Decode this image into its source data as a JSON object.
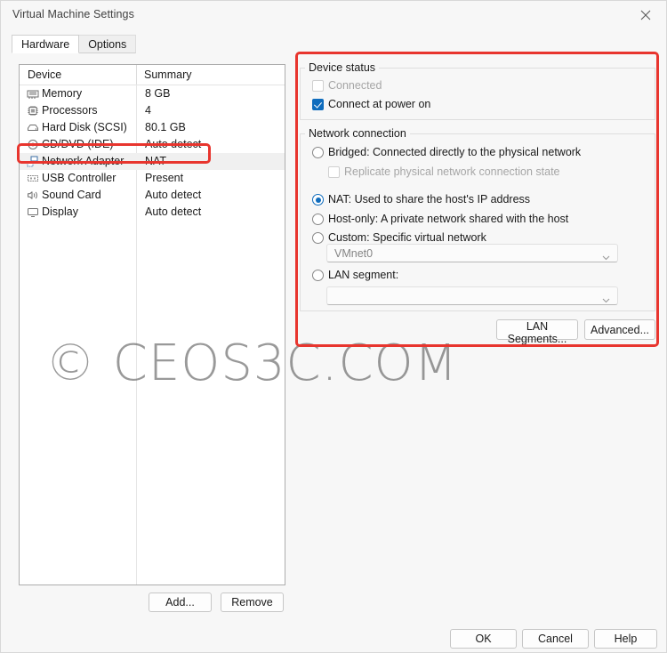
{
  "window": {
    "title": "Virtual Machine Settings",
    "close_icon": "close-icon"
  },
  "tabs": [
    {
      "label": "Hardware",
      "active": true
    },
    {
      "label": "Options",
      "active": false
    }
  ],
  "device_list": {
    "columns": {
      "device": "Device",
      "summary": "Summary"
    },
    "rows": [
      {
        "icon": "memory-icon",
        "label": "Memory",
        "summary": "8 GB",
        "selected": false
      },
      {
        "icon": "processor-icon",
        "label": "Processors",
        "summary": "4",
        "selected": false
      },
      {
        "icon": "hard-disk-icon",
        "label": "Hard Disk (SCSI)",
        "summary": "80.1 GB",
        "selected": false
      },
      {
        "icon": "cd-dvd-icon",
        "label": "CD/DVD (IDE)",
        "summary": "Auto detect",
        "selected": false
      },
      {
        "icon": "network-adapter-icon",
        "label": "Network Adapter",
        "summary": "NAT",
        "selected": true
      },
      {
        "icon": "usb-controller-icon",
        "label": "USB Controller",
        "summary": "Present",
        "selected": false
      },
      {
        "icon": "sound-card-icon",
        "label": "Sound Card",
        "summary": "Auto detect",
        "selected": false
      },
      {
        "icon": "display-icon",
        "label": "Display",
        "summary": "Auto detect",
        "selected": false
      }
    ],
    "add_label": "Add...",
    "remove_label": "Remove"
  },
  "device_status": {
    "title": "Device status",
    "connected": {
      "label": "Connected",
      "checked": false,
      "disabled": true
    },
    "connect_at_power_on": {
      "label": "Connect at power on",
      "checked": true,
      "disabled": false
    }
  },
  "network_connection": {
    "title": "Network connection",
    "options": [
      {
        "id": "bridged",
        "label": "Bridged: Connected directly to the physical network",
        "selected": false
      },
      {
        "id": "nat",
        "label": "NAT: Used to share the host's IP address",
        "selected": true
      },
      {
        "id": "host-only",
        "label": "Host-only: A private network shared with the host",
        "selected": false
      },
      {
        "id": "custom",
        "label": "Custom: Specific virtual network",
        "selected": false
      },
      {
        "id": "lan",
        "label": "LAN segment:",
        "selected": false
      }
    ],
    "replicate": {
      "label": "Replicate physical network connection state",
      "checked": false,
      "disabled": true
    },
    "custom_combo": {
      "value": "VMnet0",
      "disabled": true
    },
    "lan_combo": {
      "value": "",
      "disabled": true
    },
    "lan_segments_label": "LAN Segments...",
    "advanced_label": "Advanced..."
  },
  "footer": {
    "ok_label": "OK",
    "cancel_label": "Cancel",
    "help_label": "Help"
  },
  "annotations": {
    "highlight_color": "#e8352e",
    "accent_color": "#0f6cbd"
  },
  "watermark": {
    "text": "© CEOS3C.COM"
  }
}
